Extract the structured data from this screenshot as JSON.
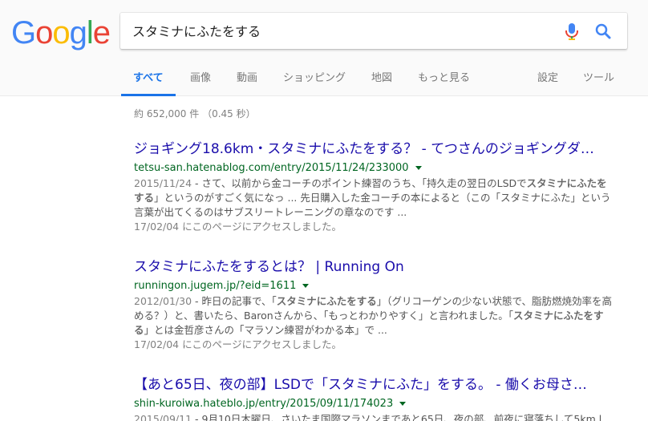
{
  "logo": {
    "letters": [
      "G",
      "o",
      "o",
      "g",
      "l",
      "e"
    ],
    "colors": [
      "#4285F4",
      "#EA4335",
      "#FBBC05",
      "#4285F4",
      "#34A853",
      "#EA4335"
    ]
  },
  "search": {
    "query": "スタミナにふたをする"
  },
  "tabs": {
    "all": "すべて",
    "images": "画像",
    "videos": "動画",
    "shopping": "ショッピング",
    "maps": "地図",
    "more": "もっと見る",
    "settings": "設定",
    "tools": "ツール"
  },
  "stats": "約 652,000 件 （0.45 秒）",
  "results": [
    {
      "title": "ジョギング18.6km・スタミナにふたをする？ - てつさんのジョギングダ…",
      "url": "tetsu-san.hatenablog.com/entry/2015/11/24/233000",
      "date": "2015/11/24",
      "snippet": [
        {
          "t": " - さて、以前から金コーチのポイント練習のうち、「持久走の翌日のLSDで",
          "b": false
        },
        {
          "t": "スタミナにふたをする",
          "b": true
        },
        {
          "t": "」というのがすごく気になっ ... 先日購入した金コーチの本によると（この「スタミナにふた」という言葉が出てくるのはサブスリートレーニングの章なのです ...",
          "b": false
        }
      ],
      "visited": "17/02/04 にこのページにアクセスしました。"
    },
    {
      "title": "スタミナにふたをするとは？ | Running On",
      "url": "runningon.jugem.jp/?eid=1611",
      "date": "2012/01/30",
      "snippet": [
        {
          "t": " - 昨日の記事で、「",
          "b": false
        },
        {
          "t": "スタミナにふたをする",
          "b": true
        },
        {
          "t": "」（グリコーゲンの少ない状態で、脂肪燃焼効率を高める？）と、書いたら、Baronさんから、「もっとわかりやすく」と言われました。「",
          "b": false
        },
        {
          "t": "スタミナにふたをする",
          "b": true
        },
        {
          "t": "」とは金哲彦さんの「マラソン練習がわかる本」で ...",
          "b": false
        }
      ],
      "visited": "17/02/04 にこのページにアクセスしました。"
    },
    {
      "title": "【あと65日、夜の部】LSDで「スタミナにふた」をする。 - 働くお母さ…",
      "url": "shin-kuroiwa.hateblo.jp/entry/2015/09/11/174023",
      "date": "2015/09/11",
      "snippet": [
        {
          "t": " - 9月10日木曜日、さいたま国際マラソンまであと65日、夜の部、前夜に寝落ちして5km l…",
          "b": false
        }
      ],
      "visited": ""
    }
  ]
}
